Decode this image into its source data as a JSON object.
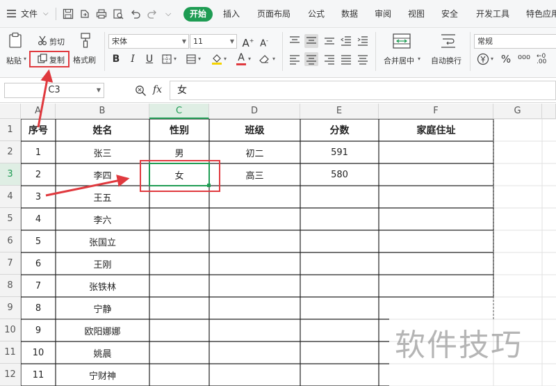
{
  "menubar": {
    "file_label": "文件",
    "tabs": [
      "开始",
      "插入",
      "页面布局",
      "公式",
      "数据",
      "审阅",
      "视图",
      "安全",
      "开发工具",
      "特色应用"
    ]
  },
  "ribbon": {
    "paste_label": "粘贴",
    "cut_label": "剪切",
    "copy_label": "复制",
    "format_painter_label": "格式刷",
    "font_name": "宋体",
    "font_size": "11",
    "merge_label": "合并居中",
    "wrap_label": "自动换行",
    "number_format": "常规"
  },
  "formula_bar": {
    "name_box": "C3",
    "fx_label": "fx",
    "value": "女"
  },
  "sheet": {
    "columns": [
      "A",
      "B",
      "C",
      "D",
      "E",
      "F",
      "G"
    ],
    "rows": [
      "1",
      "2",
      "3",
      "4",
      "5",
      "6",
      "7",
      "8",
      "9",
      "10",
      "11",
      "12"
    ],
    "headers": [
      "序号",
      "姓名",
      "性别",
      "班级",
      "分数",
      "家庭住址"
    ],
    "data": [
      [
        "1",
        "张三",
        "男",
        "初二",
        "591",
        ""
      ],
      [
        "2",
        "李四",
        "女",
        "高三",
        "580",
        ""
      ],
      [
        "3",
        "王五",
        "",
        "",
        "",
        ""
      ],
      [
        "4",
        "李六",
        "",
        "",
        "",
        ""
      ],
      [
        "5",
        "张国立",
        "",
        "",
        "",
        ""
      ],
      [
        "6",
        "王刚",
        "",
        "",
        "",
        ""
      ],
      [
        "7",
        "张铁林",
        "",
        "",
        "",
        ""
      ],
      [
        "8",
        "宁静",
        "",
        "",
        "",
        ""
      ],
      [
        "9",
        "欧阳娜娜",
        "",
        "",
        "",
        ""
      ],
      [
        "10",
        "姚晨",
        "",
        "",
        "",
        ""
      ],
      [
        "11",
        "宁财神",
        "",
        "",
        "",
        ""
      ]
    ],
    "selected_cell": "C3"
  },
  "watermark": "软件技巧",
  "colors": {
    "accent_green": "#1e9c53",
    "annotation_red": "#e0393e"
  }
}
